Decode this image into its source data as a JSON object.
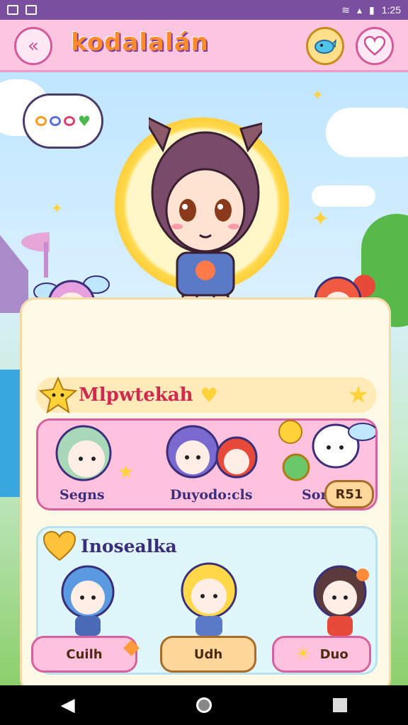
{
  "status_bar": {
    "time": "1:25"
  },
  "header": {
    "back_icon": "chevron-left-icon",
    "title": "kodalalán",
    "right_icons": [
      "whale-icon",
      "heart-icon"
    ]
  },
  "speech_bubble": {
    "text": "ooo♥"
  },
  "sections": {
    "first": {
      "title": "Mlpwtekah",
      "characters": [
        {
          "label": "Segns"
        },
        {
          "label": "Duyodo:cls"
        },
        {
          "label": "Sor"
        }
      ],
      "action_label": "R51"
    },
    "second": {
      "title": "Inosealka",
      "characters": [
        {
          "label": "Cuilh"
        },
        {
          "label": "Udh"
        },
        {
          "label": "Duo"
        }
      ]
    }
  },
  "colors": {
    "accent": "#d65a9b",
    "panel": "#fff9e6",
    "title_orange": "#ff8a2b"
  }
}
